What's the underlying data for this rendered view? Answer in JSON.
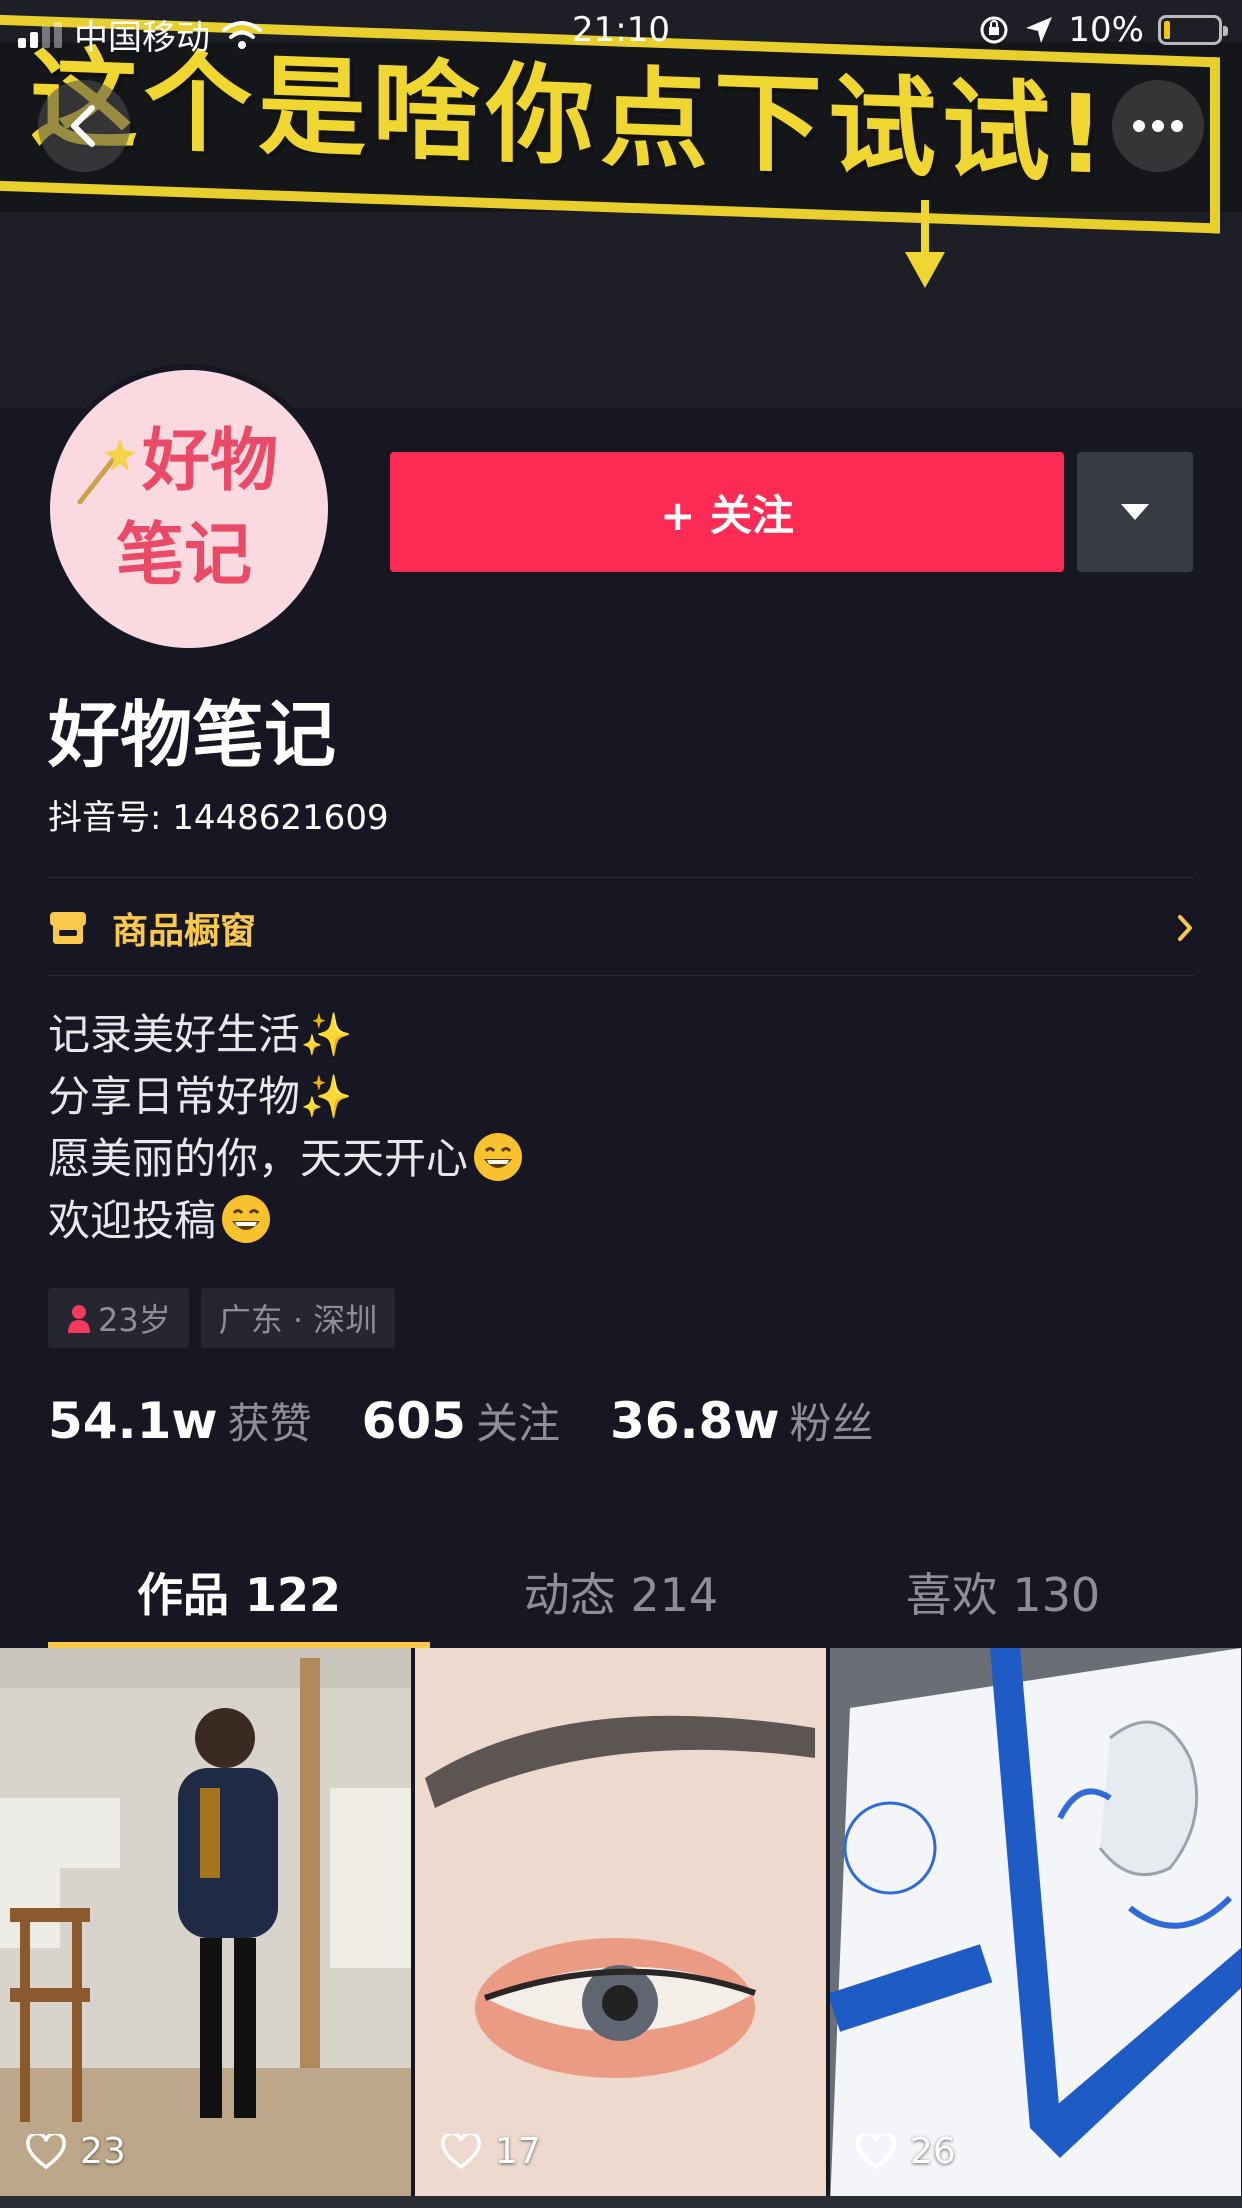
{
  "status_bar": {
    "carrier": "中国移动",
    "time": "21:10",
    "battery": "10%"
  },
  "cover": {
    "banner_text": "这个是啥你点下试试!"
  },
  "avatar": {
    "line1": "好物",
    "line2": "笔记"
  },
  "actions": {
    "follow_label": "+ 关注"
  },
  "profile": {
    "name": "好物笔记",
    "id_label": "抖音号: 1448621609"
  },
  "shop": {
    "label": "商品橱窗"
  },
  "bio": {
    "line1": "记录美好生活✨",
    "line2": "分享日常好物✨",
    "line3": "愿美丽的你，天天开心",
    "line4": "欢迎投稿"
  },
  "tags": {
    "age": "23岁",
    "location": "广东 · 深圳"
  },
  "stats": {
    "likes_num": "54.1w",
    "likes_label": "获赞",
    "following_num": "605",
    "following_label": "关注",
    "followers_num": "36.8w",
    "followers_label": "粉丝"
  },
  "tabs": [
    {
      "label": "作品 122"
    },
    {
      "label": "动态 214"
    },
    {
      "label": "喜欢 130"
    }
  ],
  "videos": [
    {
      "likes": "23"
    },
    {
      "likes": "17"
    },
    {
      "likes": "26"
    }
  ],
  "colors": {
    "follow": "#fe2c55",
    "accent": "#fac94b",
    "background": "#161722"
  }
}
